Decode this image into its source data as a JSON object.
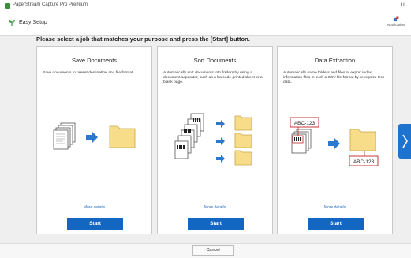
{
  "window": {
    "title": "PaperStream Capture Pro Premium",
    "min_label": "⊔"
  },
  "header": {
    "title": "Easy Setup",
    "notification_label": "Notification"
  },
  "instruction": "Please select a job that matches your purpose and press the [Start] button.",
  "panels": [
    {
      "title": "Save Documents",
      "description": "Save documents to preset destination and file format.",
      "more": "More details",
      "start": "Start"
    },
    {
      "title": "Sort Documents",
      "description": "Automatically sort documents into folders by using a document separator, such as a barcode-printed sheet or a blank page.",
      "more": "More details",
      "start": "Start"
    },
    {
      "title": "Data Extraction",
      "description": "Automatically name folders and files or export index information files in such a CSV file format by recognize text data.",
      "more": "More details",
      "start": "Start",
      "sample_tag": "ABC-123"
    }
  ],
  "footer": {
    "cancel": "Cancel"
  },
  "colors": {
    "accent": "#1366c2",
    "folder": "#f7dd8a",
    "arrow": "#2a79cf",
    "tag_border": "#c22222",
    "brand_green": "#3b8d3b"
  }
}
